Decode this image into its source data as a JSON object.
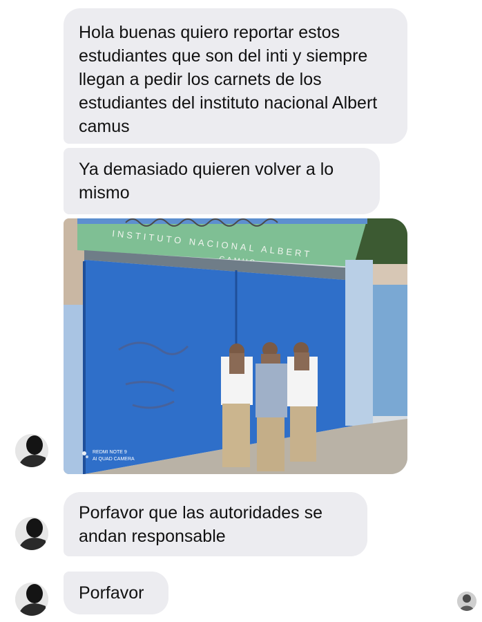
{
  "messages": [
    {
      "text": "Hola buenas quiero reportar estos estudiantes que son del inti y siempre llegan a pedir los carnets de los estudiantes del instituto nacional Albert camus"
    },
    {
      "text": "Ya demasiado quieren volver a lo mismo"
    },
    {
      "text": "Porfavor que las autoridades se andan responsable"
    },
    {
      "text": "Porfavor"
    }
  ],
  "photo": {
    "sign_line1": "INSTITUTO NACIONAL ALBERT",
    "sign_line2": "CAMUS",
    "watermark_line1": "REDMI NOTE 9",
    "watermark_line2": "AI QUAD CAMERA",
    "colors": {
      "sky": "#dfe7ee",
      "wall": "#9fb8d6",
      "sign": "#5aa777",
      "gate": "#2f6fc9",
      "pillar": "#b9cfe6",
      "ground": "#bdb6ab"
    }
  },
  "colors": {
    "bubble": "#ececf0",
    "text": "#111111",
    "background": "#ffffff"
  }
}
